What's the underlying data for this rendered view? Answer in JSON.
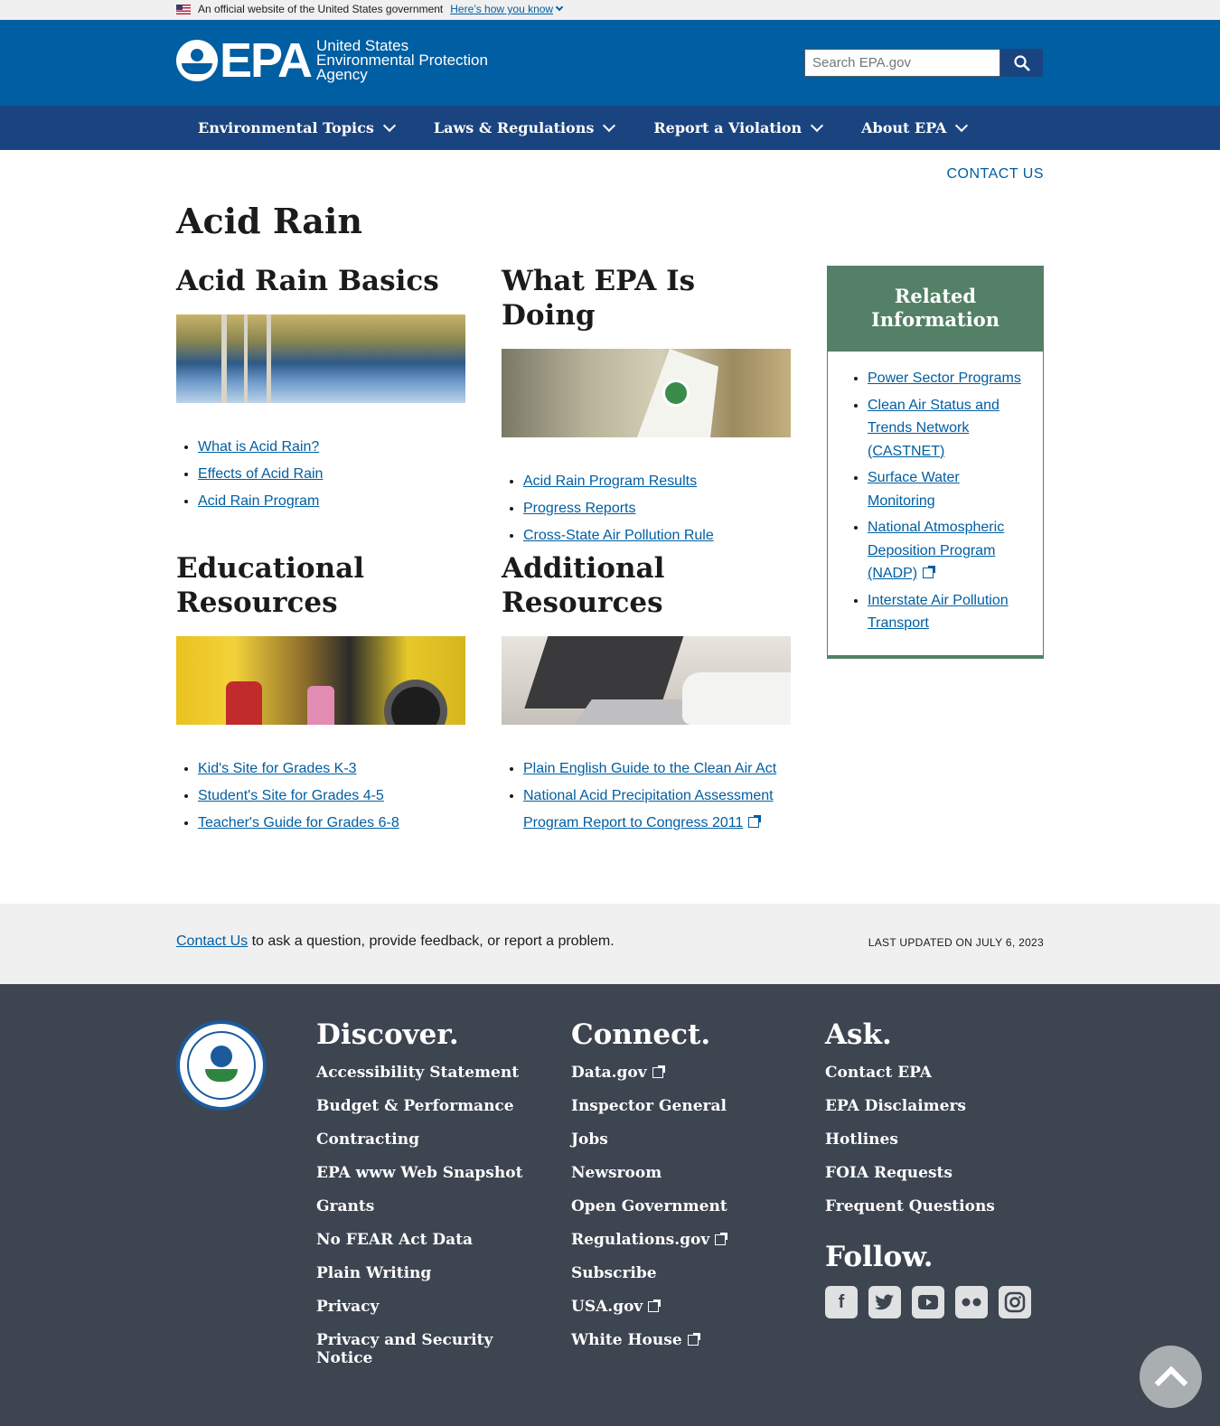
{
  "banner": {
    "text": "An official website of the United States government",
    "link": "Here’s how you know"
  },
  "header": {
    "logo_abbrev": "EPA",
    "logo_line1": "United States",
    "logo_line2": "Environmental Protection",
    "logo_line3": "Agency",
    "search_placeholder": "Search EPA.gov"
  },
  "nav": [
    "Environmental Topics",
    "Laws & Regulations",
    "Report a Violation",
    "About EPA"
  ],
  "contact_top": "CONTACT US",
  "page_title": "Acid Rain",
  "sections": [
    {
      "title": "Acid Rain Basics",
      "links": [
        "What is Acid Rain?",
        "Effects of Acid Rain",
        "Acid Rain Program"
      ]
    },
    {
      "title": "What EPA Is Doing",
      "links": [
        "Acid Rain Program Results",
        "Progress Reports",
        "Cross-State Air Pollution Rule"
      ]
    },
    {
      "title": "Educational Resources",
      "links": [
        "Kid's Site for Grades K-3",
        "Student's Site for Grades 4-5",
        "Teacher's Guide for Grades 6-8"
      ]
    },
    {
      "title": "Additional Resources",
      "links": [
        "Plain English Guide to the Clean Air Act",
        "National Acid Precipitation Assessment Program Report to Congress 2011"
      ]
    }
  ],
  "related": {
    "title": "Related Information",
    "links": [
      "Power Sector Programs",
      "Clean Air Status and Trends Network (CASTNET)",
      "Surface Water Monitoring",
      "National Atmospheric Deposition Program (NADP)",
      "Interstate Air Pollution Transport"
    ]
  },
  "contact_band": {
    "link": "Contact Us",
    "text": " to ask a question, provide feedback, or report a problem.",
    "updated": "LAST UPDATED ON JULY 6, 2023"
  },
  "footer": {
    "discover": {
      "title": "Discover.",
      "links": [
        "Accessibility Statement",
        "Budget & Performance",
        "Contracting",
        "EPA www Web Snapshot",
        "Grants",
        "No FEAR Act Data",
        "Plain Writing",
        "Privacy",
        "Privacy and Security Notice"
      ]
    },
    "connect": {
      "title": "Connect.",
      "links": [
        "Data.gov",
        "Inspector General",
        "Jobs",
        "Newsroom",
        "Open Government",
        "Regulations.gov",
        "Subscribe",
        "USA.gov",
        "White House"
      ]
    },
    "ask": {
      "title": "Ask.",
      "links": [
        "Contact EPA",
        "EPA Disclaimers",
        "Hotlines",
        "FOIA Requests",
        "Frequent Questions"
      ]
    },
    "follow": {
      "title": "Follow.",
      "icons": [
        "facebook-icon",
        "twitter-icon",
        "youtube-icon",
        "flickr-icon",
        "instagram-icon"
      ]
    }
  }
}
